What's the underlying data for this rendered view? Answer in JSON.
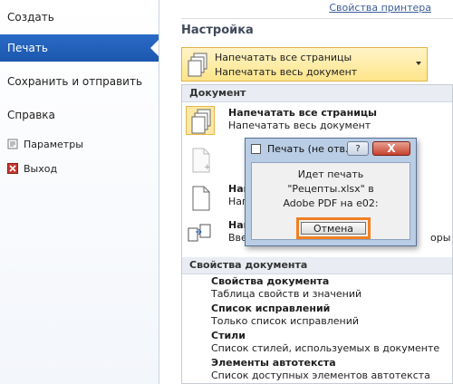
{
  "nav": {
    "create": "Создать",
    "print": "Печать",
    "save_send": "Сохранить и отправить",
    "help": "Справка",
    "options": "Параметры",
    "exit": "Выход"
  },
  "header": {
    "printer_properties": "Свойства принтера",
    "settings_title": "Настройка"
  },
  "dropdown": {
    "line1": "Напечатать все страницы",
    "line2": "Напечатать весь документ"
  },
  "menu": {
    "document_group": "Документ",
    "options": [
      {
        "title": "Напечатать все страницы",
        "desc": "Напечатать весь документ"
      },
      {
        "title": "",
        "desc": ""
      },
      {
        "title": "Нап",
        "desc": "Нап"
      },
      {
        "title": "Нап",
        "desc": "Вве",
        "desc_tail": "оры"
      }
    ],
    "properties_group": "Свойства документа",
    "properties": [
      {
        "title": "Свойства документа",
        "desc": "Таблица свойств и значений"
      },
      {
        "title": "Список исправлений",
        "desc": "Только список исправлений"
      },
      {
        "title": "Стили",
        "desc": "Список стилей, используемых в документе"
      },
      {
        "title": "Элементы автотекста",
        "desc": "Список доступных элементов автотекста"
      }
    ]
  },
  "dialog": {
    "title": "Печать (не отв...",
    "help": "?",
    "close": "X",
    "message_line1": "Идет печать",
    "message_line2": "\"Рецепты.xlsx\" в",
    "message_line3": "Adobe PDF на e02:",
    "cancel": "Отмена"
  },
  "colors": {
    "nav_active": "#1f5fb8",
    "selection": "#ffe58a",
    "highlight_outline": "#f08023",
    "dialog_frame": "#b9cde5"
  }
}
